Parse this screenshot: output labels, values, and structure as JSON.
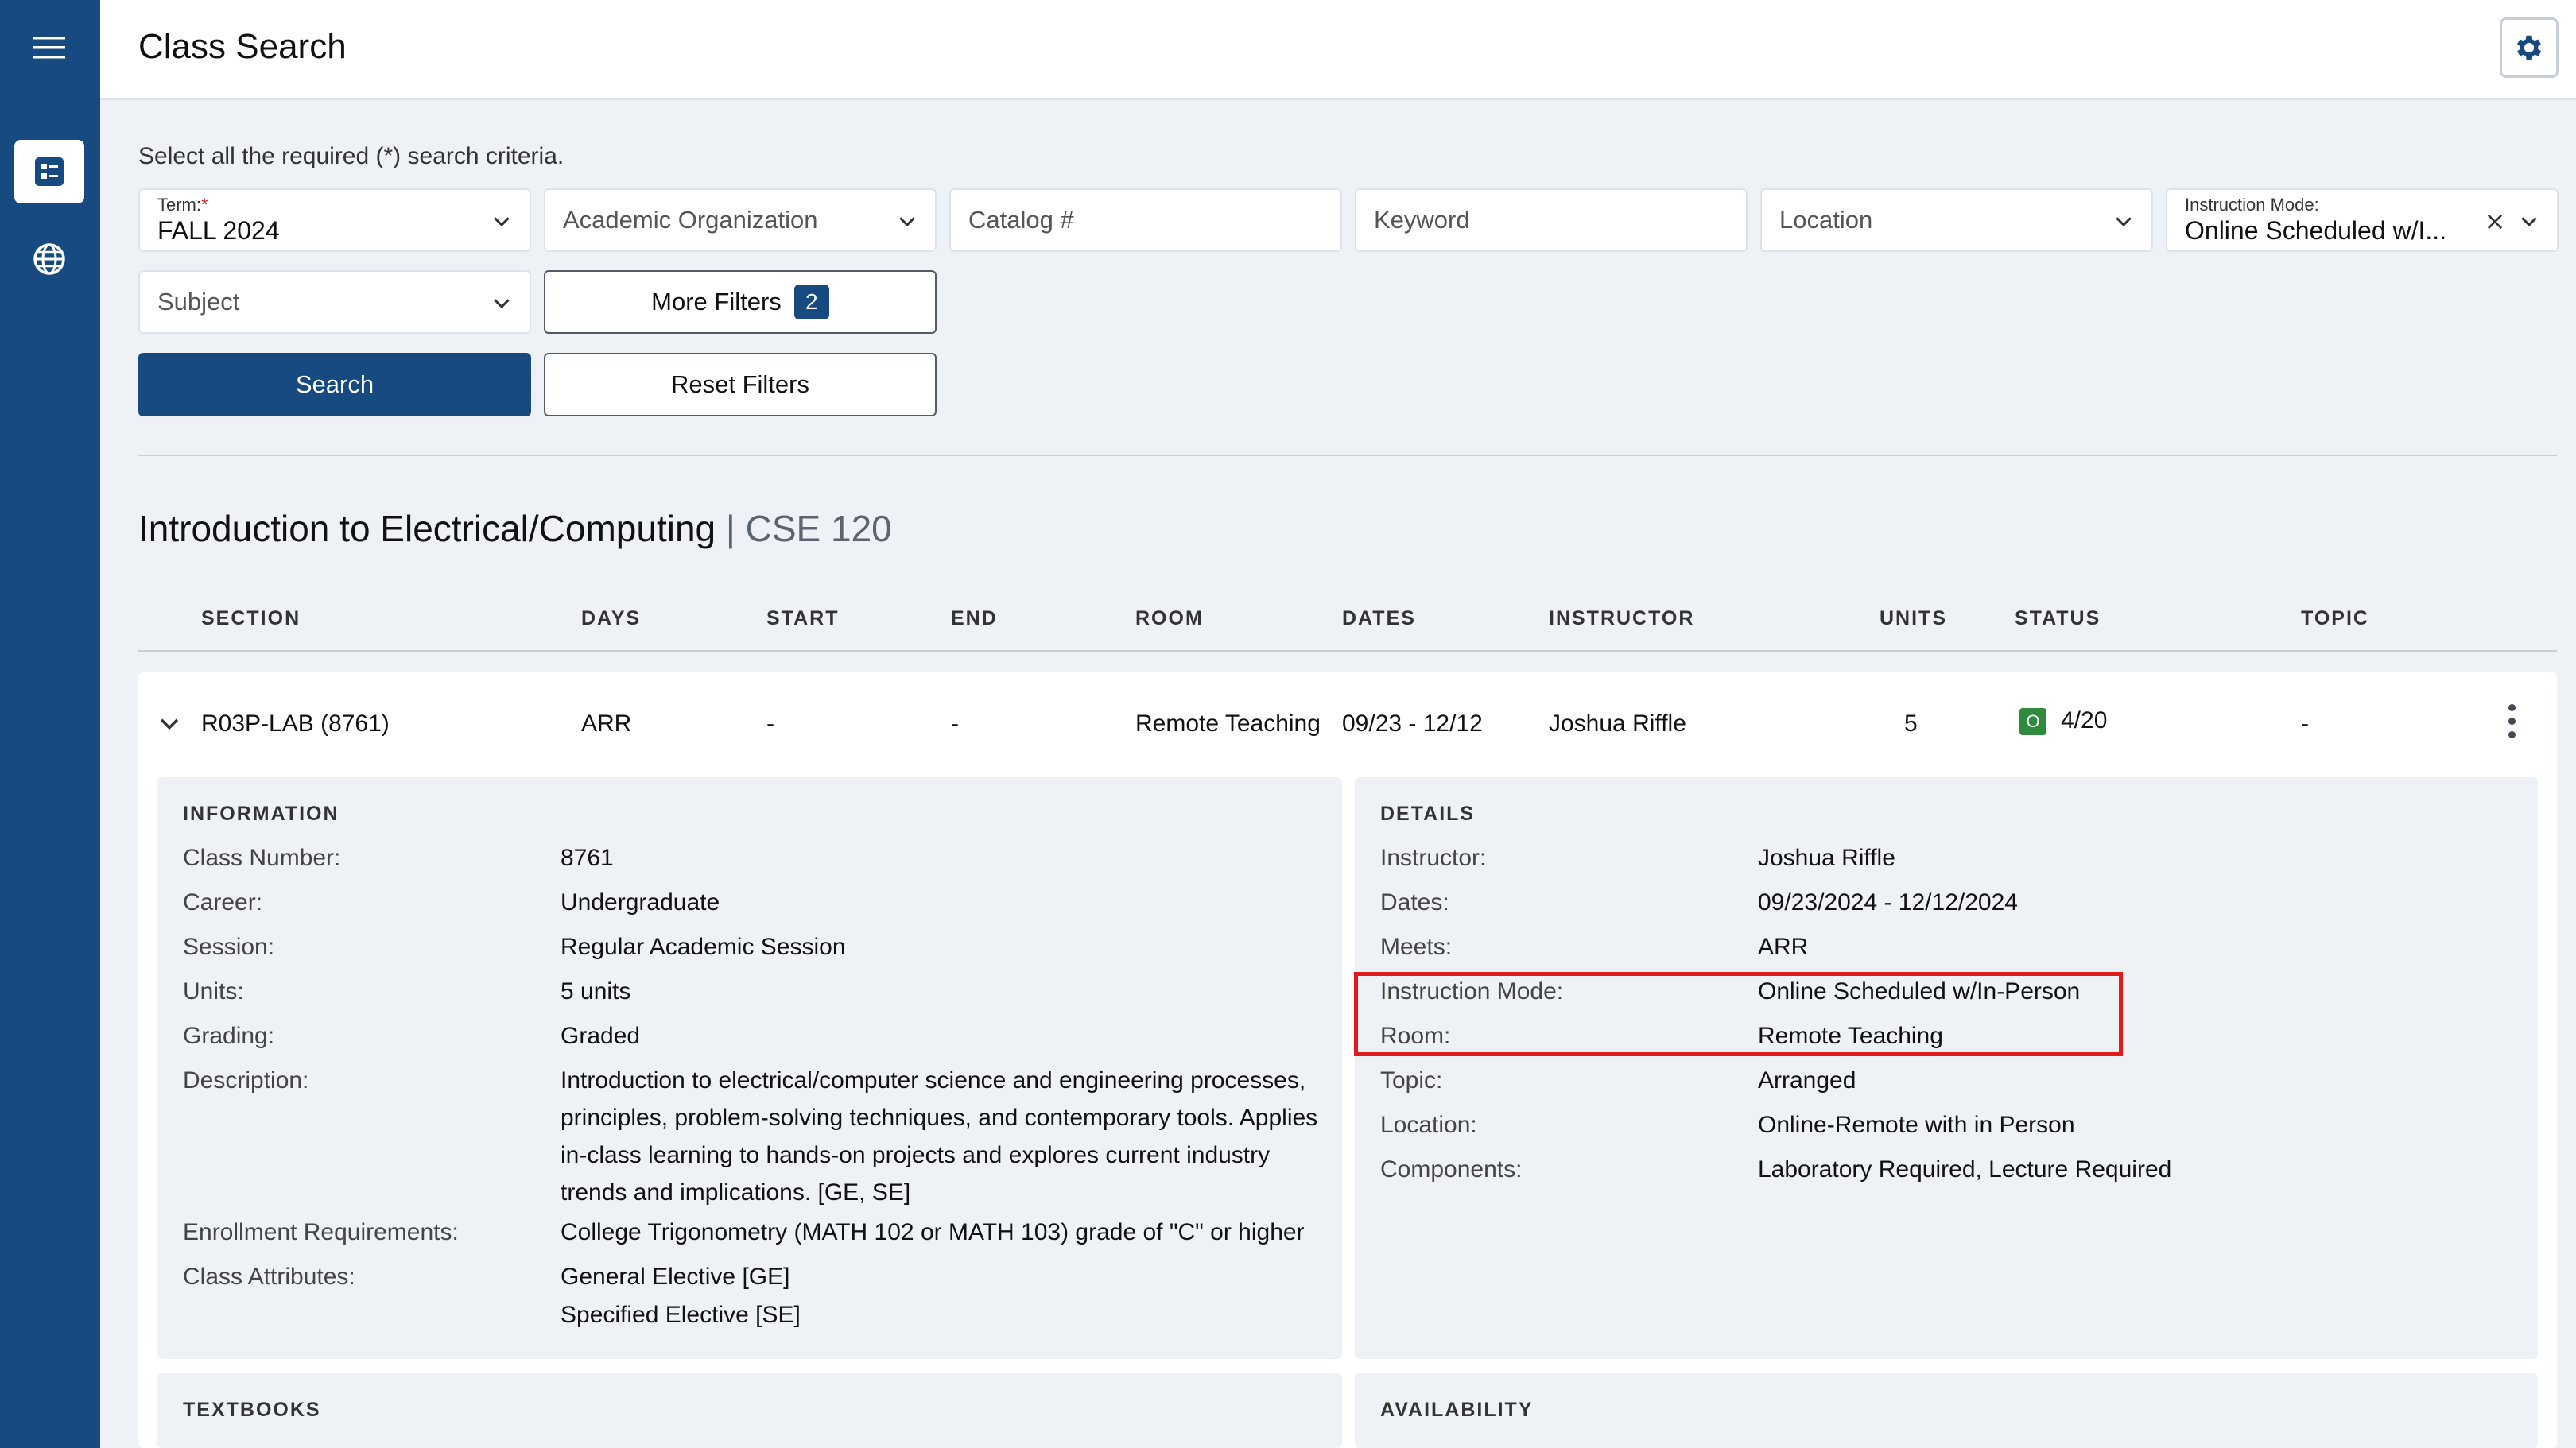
{
  "header": {
    "title": "Class Search"
  },
  "sidebar": {
    "icons": [
      "menu-icon",
      "class-search-icon",
      "globe-icon"
    ]
  },
  "search": {
    "hint": "Select all the required (*) search criteria.",
    "term_label": "Term:",
    "term_required": "*",
    "term_value": "FALL 2024",
    "academic_org_placeholder": "Academic Organization",
    "catalog_placeholder": "Catalog #",
    "keyword_placeholder": "Keyword",
    "location_placeholder": "Location",
    "instruction_mode_label": "Instruction Mode:",
    "instruction_mode_value": "Online Scheduled w/I...",
    "subject_placeholder": "Subject",
    "more_filters_label": "More Filters",
    "more_filters_count": "2",
    "search_label": "Search",
    "reset_label": "Reset Filters"
  },
  "course": {
    "title": "Introduction to Electrical/Computing",
    "separator": "|",
    "code": "CSE 120"
  },
  "table": {
    "columns": [
      "SECTION",
      "DAYS",
      "START",
      "END",
      "ROOM",
      "DATES",
      "INSTRUCTOR",
      "UNITS",
      "STATUS",
      "TOPIC"
    ],
    "row": {
      "section": "R03P-LAB (8761)",
      "days": "ARR",
      "start": "-",
      "end": "-",
      "room": "Remote Teaching",
      "dates": "09/23 - 12/12",
      "instructor": "Joshua Riffle",
      "units": "5",
      "status_badge": "O",
      "status_count": "4/20",
      "topic": "-"
    }
  },
  "information": {
    "title": "INFORMATION",
    "items": [
      {
        "key": "Class Number:",
        "value": "8761"
      },
      {
        "key": "Career:",
        "value": "Undergraduate"
      },
      {
        "key": "Session:",
        "value": "Regular Academic Session"
      },
      {
        "key": "Units:",
        "value": "5 units"
      },
      {
        "key": "Grading:",
        "value": "Graded"
      },
      {
        "key": "Description:",
        "value": "Introduction to electrical/computer science and engineering processes, principles, problem-solving techniques, and contemporary tools. Applies in-class learning to hands-on projects and explores current industry trends and implications. [GE, SE]"
      },
      {
        "key": "Enrollment Requirements:",
        "value": "College Trigonometry (MATH 102 or MATH 103) grade of \"C\" or higher"
      },
      {
        "key": "Class Attributes:",
        "value": "General Elective [GE]"
      },
      {
        "key": "",
        "value": "Specified Elective [SE]"
      }
    ]
  },
  "details": {
    "title": "DETAILS",
    "items": [
      {
        "key": "Instructor:",
        "value": "Joshua Riffle"
      },
      {
        "key": "Dates:",
        "value": "09/23/2024 - 12/12/2024"
      },
      {
        "key": "Meets:",
        "value": "ARR"
      },
      {
        "key": "Instruction Mode:",
        "value": "Online Scheduled w/In-Person"
      },
      {
        "key": "Room:",
        "value": "Remote Teaching"
      },
      {
        "key": "Topic:",
        "value": "Arranged"
      },
      {
        "key": "Location:",
        "value": "Online-Remote with in Person"
      },
      {
        "key": "Components:",
        "value": "Laboratory Required, Lecture Required"
      }
    ]
  },
  "textbooks": {
    "title": "TEXTBOOKS"
  },
  "availability": {
    "title": "AVAILABILITY"
  },
  "colors": {
    "primary": "#164a80",
    "status_open": "#2e8b3e",
    "highlight": "#e01b1b",
    "background": "#eef1f6"
  }
}
